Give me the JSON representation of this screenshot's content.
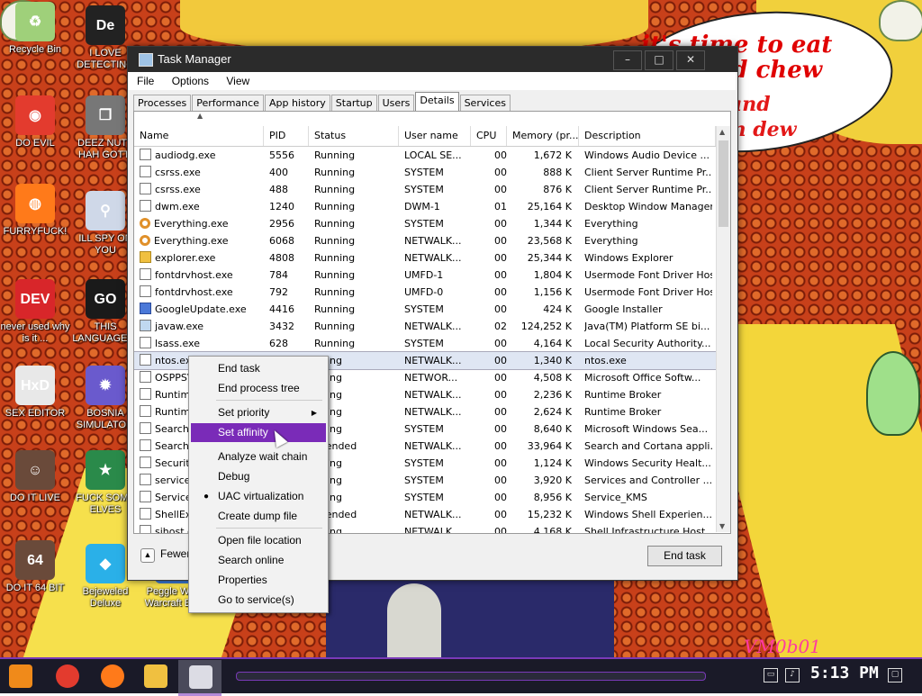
{
  "desktop": {
    "speech_text": "it's time to eat shit and chew",
    "speech_ghost": "s and\nain dew",
    "watermark": "VM0b01",
    "icons": [
      {
        "label": "Recycle Bin",
        "name": "recycle-bin-icon",
        "color": "#9fd07a",
        "glyph": "♻"
      },
      {
        "label": "I LOVE DETECTING",
        "name": "detecting-app-icon",
        "color": "#222222",
        "glyph": "De"
      },
      {
        "label": "DO EVIL",
        "name": "chrome-icon",
        "color": "#e33b2e",
        "glyph": "◉"
      },
      {
        "label": "DEEZ NUTZ HAH GOTTI",
        "name": "stacked-windows-icon",
        "color": "#777777",
        "glyph": "❐"
      },
      {
        "label": "FURRYFUCK!",
        "name": "firefox-icon",
        "color": "#ff7a1a",
        "glyph": "◍"
      },
      {
        "label": "ILL SPY ON YOU",
        "name": "satellite-icon",
        "color": "#cfd8e8",
        "glyph": "⚲"
      },
      {
        "label": "never used why is it ...",
        "name": "dev-cpp-icon",
        "color": "#d8262a",
        "glyph": "DEV"
      },
      {
        "label": "THIS LANGUAGE ...",
        "name": "goland-icon",
        "color": "#1a1a1a",
        "glyph": "GO"
      },
      {
        "label": "SEX EDITOR",
        "name": "hxd-editor-icon",
        "color": "#e8e8e8",
        "glyph": "HxD"
      },
      {
        "label": "BOSNIA SIMULATO...",
        "name": "mine-icon",
        "color": "#6a5acd",
        "glyph": "✹"
      },
      {
        "label": "DO IT LIVE",
        "name": "portrait-icon",
        "color": "#6a4a3a",
        "glyph": "☺"
      },
      {
        "label": "FUCK SOME ELVES",
        "name": "elf-game-icon",
        "color": "#2a8a4a",
        "glyph": "★"
      },
      {
        "label": "DO IT 64 BIT",
        "name": "portrait-64-icon",
        "color": "#6a4a3a",
        "glyph": "64"
      },
      {
        "label": "Bejeweled Deluxe",
        "name": "bejeweled-icon",
        "color": "#2ab0e8",
        "glyph": "◆"
      },
      {
        "label": "Peggle Wo... Warcraft Ed...",
        "name": "peggle-icon",
        "color": "#3a7ad8",
        "glyph": "◐"
      }
    ]
  },
  "window": {
    "title": "Task Manager",
    "minimize": "–",
    "maximize": "□",
    "close": "✕",
    "menu": [
      "File",
      "Options",
      "View"
    ],
    "tabs": [
      "Processes",
      "Performance",
      "App history",
      "Startup",
      "Users",
      "Details",
      "Services"
    ],
    "active_tab": "Details",
    "columns": [
      "Name",
      "PID",
      "Status",
      "User name",
      "CPU",
      "Memory (pr...",
      "Description"
    ],
    "rows": [
      {
        "name": "audiodg.exe",
        "pid": "5556",
        "status": "Running",
        "user": "LOCAL SE...",
        "cpu": "00",
        "mem": "1,672 K",
        "desc": "Windows Audio Device ...",
        "icon": "win"
      },
      {
        "name": "csrss.exe",
        "pid": "400",
        "status": "Running",
        "user": "SYSTEM",
        "cpu": "00",
        "mem": "888 K",
        "desc": "Client Server Runtime Pr...",
        "icon": "win"
      },
      {
        "name": "csrss.exe",
        "pid": "488",
        "status": "Running",
        "user": "SYSTEM",
        "cpu": "00",
        "mem": "876 K",
        "desc": "Client Server Runtime Pr...",
        "icon": "win"
      },
      {
        "name": "dwm.exe",
        "pid": "1240",
        "status": "Running",
        "user": "DWM-1",
        "cpu": "01",
        "mem": "25,164 K",
        "desc": "Desktop Window Manager",
        "icon": "win"
      },
      {
        "name": "Everything.exe",
        "pid": "2956",
        "status": "Running",
        "user": "SYSTEM",
        "cpu": "00",
        "mem": "1,344 K",
        "desc": "Everything",
        "icon": "mag"
      },
      {
        "name": "Everything.exe",
        "pid": "6068",
        "status": "Running",
        "user": "NETWALK...",
        "cpu": "00",
        "mem": "23,568 K",
        "desc": "Everything",
        "icon": "mag"
      },
      {
        "name": "explorer.exe",
        "pid": "4808",
        "status": "Running",
        "user": "NETWALK...",
        "cpu": "00",
        "mem": "25,344 K",
        "desc": "Windows Explorer",
        "icon": "fold"
      },
      {
        "name": "fontdrvhost.exe",
        "pid": "784",
        "status": "Running",
        "user": "UMFD-1",
        "cpu": "00",
        "mem": "1,804 K",
        "desc": "Usermode Font Driver Host",
        "icon": "win"
      },
      {
        "name": "fontdrvhost.exe",
        "pid": "792",
        "status": "Running",
        "user": "UMFD-0",
        "cpu": "00",
        "mem": "1,156 K",
        "desc": "Usermode Font Driver Host",
        "icon": "win"
      },
      {
        "name": "GoogleUpdate.exe",
        "pid": "4416",
        "status": "Running",
        "user": "SYSTEM",
        "cpu": "00",
        "mem": "424 K",
        "desc": "Google Installer",
        "icon": "goog"
      },
      {
        "name": "javaw.exe",
        "pid": "3432",
        "status": "Running",
        "user": "NETWALK...",
        "cpu": "02",
        "mem": "124,252 K",
        "desc": "Java(TM) Platform SE bi...",
        "icon": "jav"
      },
      {
        "name": "lsass.exe",
        "pid": "628",
        "status": "Running",
        "user": "SYSTEM",
        "cpu": "00",
        "mem": "4,164 K",
        "desc": "Local Security Authority...",
        "icon": "win"
      },
      {
        "name": "ntos.exe",
        "pid": "",
        "status": "nning",
        "user": "NETWALK...",
        "cpu": "00",
        "mem": "1,340 K",
        "desc": "ntos.exe",
        "icon": "win",
        "selected": true
      },
      {
        "name": "OSPPSV",
        "pid": "",
        "status": "nning",
        "user": "NETWOR...",
        "cpu": "00",
        "mem": "4,508 K",
        "desc": "Microsoft Office Softw...",
        "icon": "win"
      },
      {
        "name": "Runtime",
        "pid": "",
        "status": "nning",
        "user": "NETWALK...",
        "cpu": "00",
        "mem": "2,236 K",
        "desc": "Runtime Broker",
        "icon": "win"
      },
      {
        "name": "Runtime",
        "pid": "",
        "status": "nning",
        "user": "NETWALK...",
        "cpu": "00",
        "mem": "2,624 K",
        "desc": "Runtime Broker",
        "icon": "win"
      },
      {
        "name": "SearchI",
        "pid": "",
        "status": "nning",
        "user": "SYSTEM",
        "cpu": "00",
        "mem": "8,640 K",
        "desc": "Microsoft Windows Sea...",
        "icon": "win"
      },
      {
        "name": "SearchU",
        "pid": "",
        "status": "spended",
        "user": "NETWALK...",
        "cpu": "00",
        "mem": "33,964 K",
        "desc": "Search and Cortana appli...",
        "icon": "win"
      },
      {
        "name": "Securit",
        "pid": "",
        "status": "nning",
        "user": "SYSTEM",
        "cpu": "00",
        "mem": "1,124 K",
        "desc": "Windows Security Healt...",
        "icon": "win"
      },
      {
        "name": "services",
        "pid": "",
        "status": "nning",
        "user": "SYSTEM",
        "cpu": "00",
        "mem": "3,920 K",
        "desc": "Services and Controller ...",
        "icon": "win"
      },
      {
        "name": "Service",
        "pid": "",
        "status": "nning",
        "user": "SYSTEM",
        "cpu": "00",
        "mem": "8,956 K",
        "desc": "Service_KMS",
        "icon": "win"
      },
      {
        "name": "ShellEx",
        "pid": "",
        "status": "spended",
        "user": "NETWALK...",
        "cpu": "00",
        "mem": "15,232 K",
        "desc": "Windows Shell Experien...",
        "icon": "win"
      },
      {
        "name": "sihost.e",
        "pid": "",
        "status": "nning",
        "user": "NETWALK...",
        "cpu": "00",
        "mem": "4,168 K",
        "desc": "Shell Infrastructure Host",
        "icon": "win"
      }
    ],
    "fewer_details": "Fewer details",
    "end_task": "End task"
  },
  "context_menu": {
    "items": [
      {
        "label": "End task"
      },
      {
        "label": "End process tree"
      },
      {
        "label": "Set priority",
        "submenu": true
      },
      {
        "label": "Set affinity",
        "highlighted": true
      },
      {
        "label": "Analyze wait chain"
      },
      {
        "label": "Debug"
      },
      {
        "label": "UAC virtualization",
        "checked": true
      },
      {
        "label": "Create dump file"
      },
      {
        "label": "Open file location"
      },
      {
        "label": "Search online"
      },
      {
        "label": "Properties"
      },
      {
        "label": "Go to service(s)"
      }
    ],
    "highlight_color": "#7a2bb8"
  },
  "taskbar": {
    "clock": "5:13 PM",
    "accent": "#7a3ab8"
  }
}
